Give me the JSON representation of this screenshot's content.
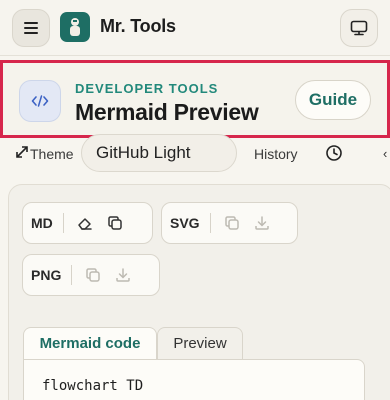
{
  "app": {
    "brand": "Mr. Tools",
    "accent_color": "#1e6e64",
    "highlight_color": "#d6264c",
    "icons": {
      "menu": "hamburger-icon",
      "logo": "tools-logo-icon",
      "display": "monitor-icon"
    }
  },
  "header": {
    "kicker": "DEVELOPER TOOLS",
    "title": "Mermaid Preview",
    "guide_label": "Guide",
    "icon": "code-icon"
  },
  "toolbar": {
    "theme_label": "Theme",
    "theme_value": "GitHub Light",
    "history_label": "History",
    "icons": {
      "expand": "expand-icon",
      "history": "clock-icon"
    }
  },
  "actions": {
    "md_label": "MD",
    "svg_label": "SVG",
    "png_label": "PNG",
    "icons": {
      "clear": "eraser-icon",
      "copy": "copy-icon",
      "download": "download-icon"
    }
  },
  "editor": {
    "tabs": [
      {
        "label": "Mermaid code",
        "active": true
      },
      {
        "label": "Preview",
        "active": false
      }
    ],
    "code_line": "flowchart TD"
  }
}
